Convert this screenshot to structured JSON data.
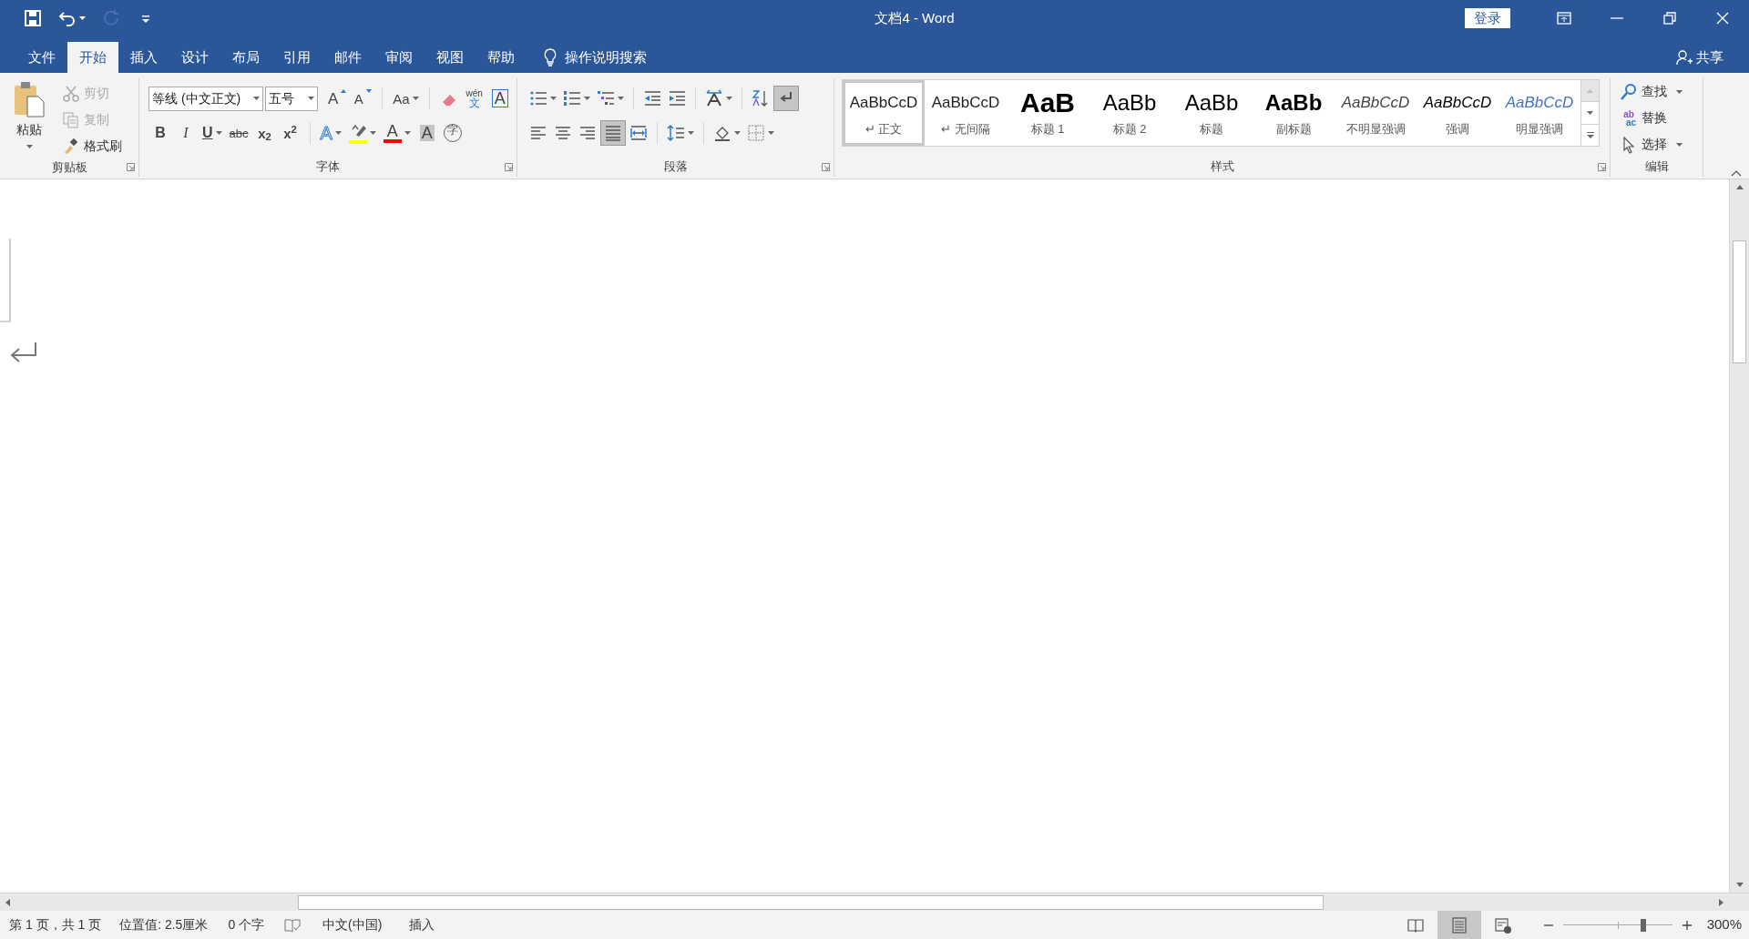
{
  "window": {
    "title": "文档4 - Word",
    "sign_in": "登录"
  },
  "quick_access": [
    {
      "kind": "save",
      "disabled": false,
      "dropdown": false
    },
    {
      "kind": "undo",
      "disabled": false,
      "dropdown": true
    },
    {
      "kind": "redo",
      "disabled": true,
      "dropdown": false
    },
    {
      "kind": "customize",
      "disabled": false,
      "dropdown": false
    }
  ],
  "tabs": [
    {
      "label": "文件",
      "selected": false
    },
    {
      "label": "开始",
      "selected": true
    },
    {
      "label": "插入",
      "selected": false
    },
    {
      "label": "设计",
      "selected": false
    },
    {
      "label": "布局",
      "selected": false
    },
    {
      "label": "引用",
      "selected": false
    },
    {
      "label": "邮件",
      "selected": false
    },
    {
      "label": "审阅",
      "selected": false
    },
    {
      "label": "视图",
      "selected": false
    },
    {
      "label": "帮助",
      "selected": false
    }
  ],
  "tell_me": "操作说明搜索",
  "share": "共享",
  "clipboard": {
    "label": "剪贴板",
    "paste": "粘贴",
    "items": [
      {
        "kind": "cut",
        "label": "剪切",
        "disabled": true
      },
      {
        "kind": "copy",
        "label": "复制",
        "disabled": true
      },
      {
        "kind": "brush",
        "label": "格式刷",
        "disabled": false
      }
    ]
  },
  "font": {
    "label": "字体",
    "font_name": "等线 (中文正文)",
    "font_size": "五号",
    "row1": [
      {
        "kind": "grow",
        "text": "A",
        "dropdown": false
      },
      {
        "kind": "shrink",
        "text": "A",
        "dropdown": false
      },
      {
        "kind": "separator"
      },
      {
        "kind": "case",
        "text": "Aa",
        "dropdown": true
      },
      {
        "kind": "separator"
      },
      {
        "kind": "eraser",
        "dropdown": false
      },
      {
        "kind": "phonetic",
        "ruby": "wén",
        "text": "文",
        "dropdown": false
      },
      {
        "kind": "border",
        "text": "A",
        "dropdown": false
      }
    ],
    "row2": [
      {
        "kind": "bold",
        "text": "B",
        "dropdown": false
      },
      {
        "kind": "italic",
        "text": "I",
        "dropdown": false
      },
      {
        "kind": "underline",
        "text": "U",
        "dropdown": true
      },
      {
        "kind": "strike",
        "text": "abc",
        "dropdown": false
      },
      {
        "kind": "script",
        "text": "x$_{2}$",
        "dropdown": false
      },
      {
        "kind": "script",
        "text": "x$^{2}$",
        "dropdown": false
      },
      {
        "kind": "separator"
      },
      {
        "kind": "effect",
        "text": "A",
        "dropdown": true
      },
      {
        "kind": "highlight",
        "color": "#ffff00",
        "dropdown": true
      },
      {
        "kind": "fontcolor",
        "text": "A",
        "color": "#ff0000",
        "dropdown": true
      },
      {
        "kind": "shading",
        "text": "A",
        "dropdown": false
      },
      {
        "kind": "enclose",
        "text": "字",
        "dropdown": false
      }
    ]
  },
  "paragraph": {
    "label": "段落",
    "row1": [
      {
        "kind": "bullets",
        "dropdown": true,
        "selected": false
      },
      {
        "kind": "numbering",
        "dropdown": true,
        "selected": false
      },
      {
        "kind": "multilevel",
        "dropdown": true,
        "selected": false
      },
      {
        "kind": "separator"
      },
      {
        "kind": "outdent",
        "dropdown": false,
        "selected": false
      },
      {
        "kind": "indent",
        "dropdown": false,
        "selected": false
      },
      {
        "kind": "separator"
      },
      {
        "kind": "asian",
        "dropdown": true,
        "selected": false
      },
      {
        "kind": "separator"
      },
      {
        "kind": "sort",
        "dropdown": false,
        "selected": false
      },
      {
        "kind": "marks",
        "dropdown": false,
        "selected": true
      }
    ],
    "row2": [
      {
        "kind": "left",
        "dropdown": false,
        "selected": false
      },
      {
        "kind": "center",
        "dropdown": false,
        "selected": false
      },
      {
        "kind": "right",
        "dropdown": false,
        "selected": false
      },
      {
        "kind": "justify",
        "dropdown": false,
        "selected": true
      },
      {
        "kind": "distribute",
        "dropdown": false,
        "selected": false
      },
      {
        "kind": "separator"
      },
      {
        "kind": "spacing",
        "dropdown": true,
        "selected": false
      },
      {
        "kind": "separator"
      },
      {
        "kind": "fill",
        "dropdown": true,
        "selected": false
      },
      {
        "kind": "borders",
        "dropdown": true,
        "selected": false
      }
    ]
  },
  "styles": {
    "label": "样式",
    "items": [
      {
        "kind": "normal",
        "sample": "AaBbCcD",
        "mark": "↵",
        "label": "正文",
        "selected": true
      },
      {
        "kind": "normal",
        "sample": "AaBbCcD",
        "mark": "↵",
        "label": "无间隔",
        "selected": false
      },
      {
        "kind": "heading1",
        "sample": "AaB",
        "label": "标题 1",
        "selected": false
      },
      {
        "kind": "heading2",
        "sample": "AaBb",
        "label": "标题 2",
        "selected": false
      },
      {
        "kind": "title",
        "sample": "AaBb",
        "label": "标题",
        "selected": false
      },
      {
        "kind": "subtitle",
        "sample": "AaBb",
        "label": "副标题",
        "selected": false
      },
      {
        "kind": "subtle",
        "sample": "AaBbCcD",
        "label": "不明显强调",
        "selected": false
      },
      {
        "kind": "emphasis",
        "sample": "AaBbCcD",
        "label": "强调",
        "selected": false
      },
      {
        "kind": "intense",
        "sample": "AaBbCcD",
        "label": "明显强调",
        "selected": false
      }
    ]
  },
  "editing": {
    "label": "编辑",
    "items": [
      {
        "kind": "find",
        "label": "查找",
        "dropdown": true
      },
      {
        "kind": "replace",
        "label": "替换",
        "dropdown": false,
        "top": "ab",
        "bottom": "ac"
      },
      {
        "kind": "select",
        "label": "选择",
        "dropdown": true
      }
    ]
  },
  "status_bar": {
    "page": "第 1 页，共 1 页",
    "position": "位置值: 2.5厘米",
    "words": "0 个字",
    "language": "中文(中国)",
    "mode": "插入",
    "views": [
      {
        "kind": "read",
        "selected": false
      },
      {
        "kind": "print",
        "selected": true
      },
      {
        "kind": "web",
        "selected": false
      }
    ],
    "zoom": {
      "level": 0.74,
      "reading": "300%"
    }
  }
}
